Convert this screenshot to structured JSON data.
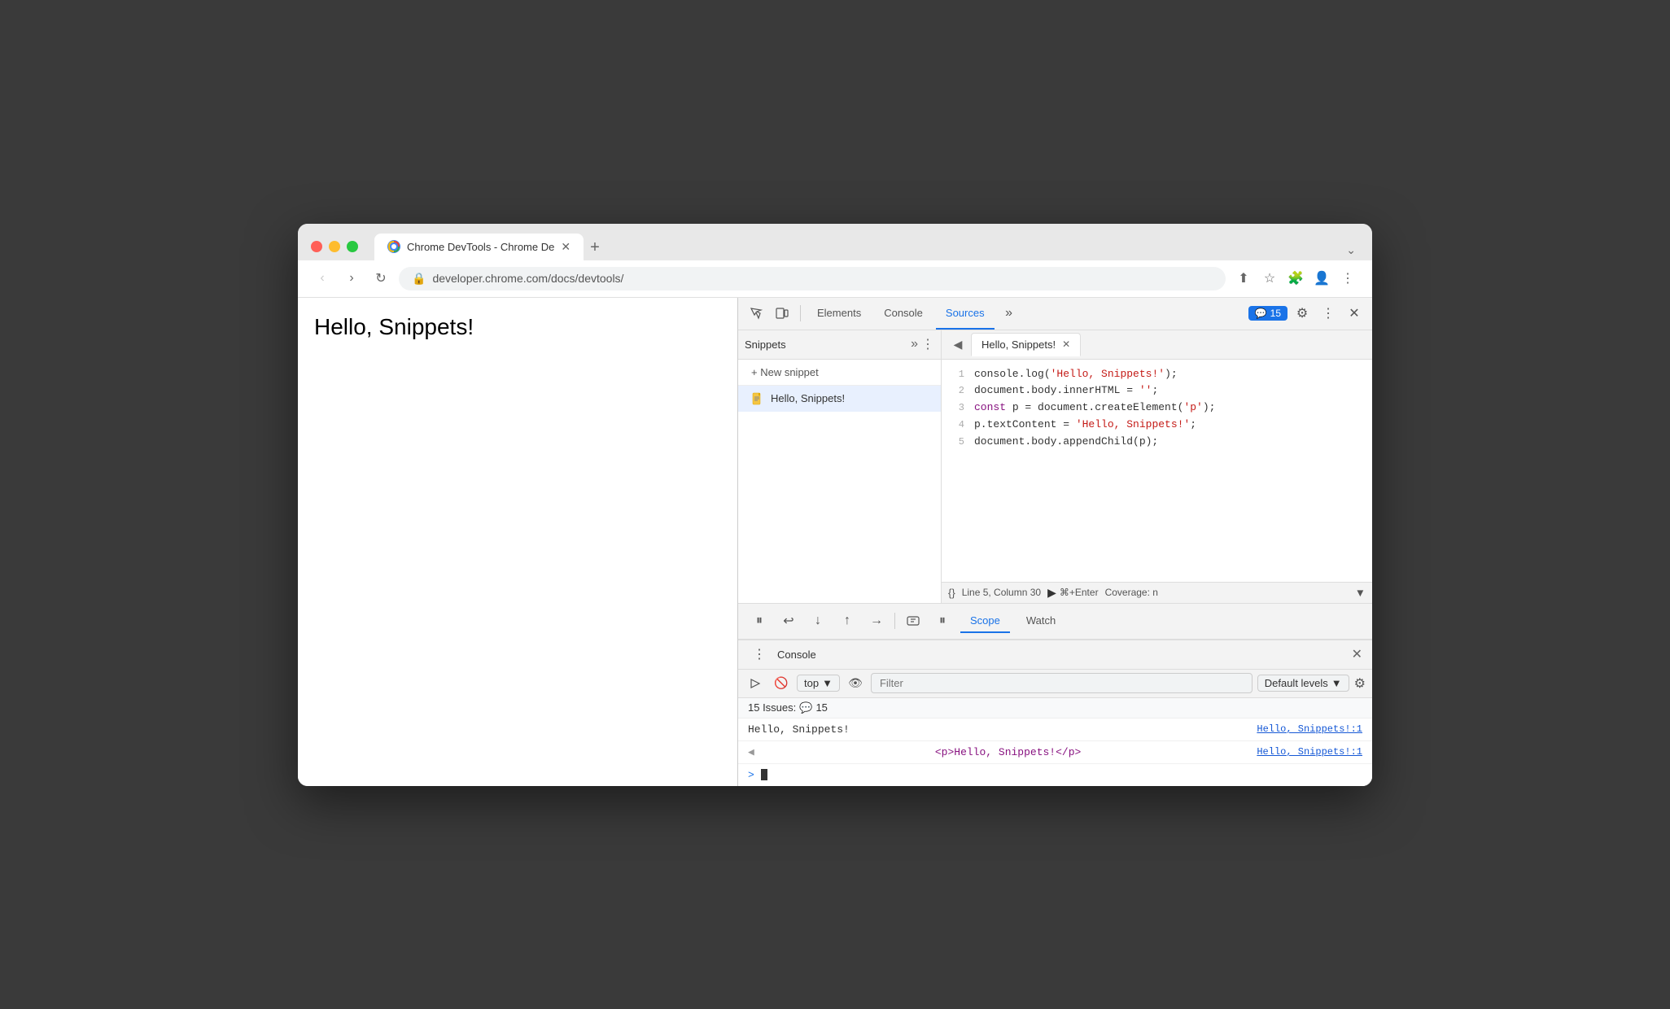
{
  "browser": {
    "tab_title": "Chrome DevTools - Chrome De",
    "url": "developer.chrome.com/docs/devtools/",
    "page_text": "Hello, Snippets!"
  },
  "devtools": {
    "tabs": [
      "Elements",
      "Console",
      "Sources"
    ],
    "active_tab": "Sources",
    "issues_count": "15",
    "more_tabs_icon": "≫",
    "settings_icon": "⚙",
    "more_options_icon": "⋮",
    "close_icon": "✕"
  },
  "sources": {
    "panel_tabs": [
      "Snippets"
    ],
    "snippets_more": "≫",
    "new_snippet_label": "+ New snippet",
    "snippet_item_name": "Hello, Snippets!",
    "editor_file_name": "Hello, Snippets!",
    "code_lines": [
      {
        "num": "1",
        "code": "console.log('Hello, Snippets!');"
      },
      {
        "num": "2",
        "code": "document.body.innerHTML = '';"
      },
      {
        "num": "3",
        "code": "const p = document.createElement('p');"
      },
      {
        "num": "4",
        "code": "p.textContent = 'Hello, Snippets!';"
      },
      {
        "num": "5",
        "code": "document.body.appendChild(p);"
      }
    ],
    "status_line": "Line 5, Column 30",
    "run_shortcut": "⌘+Enter",
    "coverage_label": "Coverage: n",
    "format_btn": "{}",
    "run_icon": "▶"
  },
  "debugger": {
    "scope_label": "Scope",
    "watch_label": "Watch"
  },
  "console": {
    "title": "Console",
    "filter_placeholder": "Filter",
    "top_label": "top",
    "default_levels_label": "Default levels",
    "issues_bar": "15 Issues:",
    "issues_count_badge": "15",
    "entries": [
      {
        "type": "log",
        "text": "Hello, Snippets!",
        "link": "Hello, Snippets!:1"
      },
      {
        "type": "html",
        "prefix": "◀",
        "text": "  <p>Hello, Snippets!</p>",
        "link": "Hello, Snippets!:1"
      }
    ],
    "prompt_arrow": ">"
  }
}
